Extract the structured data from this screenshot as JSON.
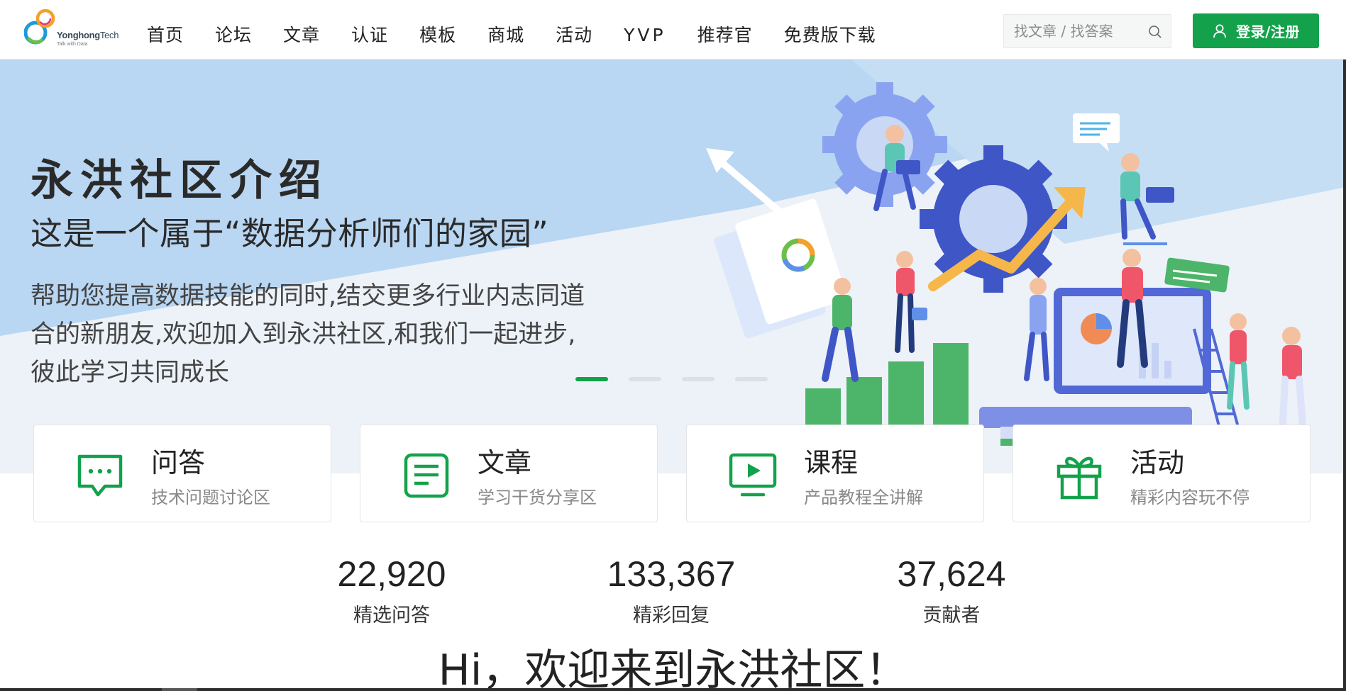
{
  "logo": {
    "brand": "Yonghong",
    "brand_suffix": "Tech",
    "tagline": "Talk with Data"
  },
  "nav": {
    "items": [
      "首页",
      "论坛",
      "文章",
      "认证",
      "模板",
      "商城",
      "活动",
      "YVP",
      "推荐官",
      "免费版下载"
    ]
  },
  "search": {
    "placeholder": "找文章 / 找答案",
    "icon": "search-icon"
  },
  "login": {
    "label": "登录/注册",
    "icon": "user-icon",
    "color": "#13a24b"
  },
  "hero": {
    "title": "永洪社区介绍",
    "subtitle": "这是一个属于“数据分析师们的家园”",
    "description_lines": [
      "帮助您提高数据技能的同时,结交更多行业内志同道",
      "合的新朋友,欢迎加入到永洪社区,和我们一起进步,",
      "彼此学习共同成长"
    ],
    "carousel": {
      "slides": 4,
      "active": 1
    }
  },
  "cards": [
    {
      "title": "问答",
      "subtitle": "技术问题讨论区",
      "icon": "chat-bubble-icon"
    },
    {
      "title": "文章",
      "subtitle": "学习干货分享区",
      "icon": "article-icon"
    },
    {
      "title": "课程",
      "subtitle": "产品教程全讲解",
      "icon": "video-play-icon"
    },
    {
      "title": "活动",
      "subtitle": "精彩内容玩不停",
      "icon": "gift-icon"
    }
  ],
  "stats": [
    {
      "value": "22,920",
      "label": "精选问答"
    },
    {
      "value": "133,367",
      "label": "精彩回复"
    },
    {
      "value": "37,624",
      "label": "贡献者"
    }
  ],
  "welcome": {
    "text": "Hi，欢迎来到永洪社区！"
  },
  "colors": {
    "accent": "#13a24b",
    "banner_blue": "#b9d6f2",
    "highlight": "#cfeedd"
  }
}
